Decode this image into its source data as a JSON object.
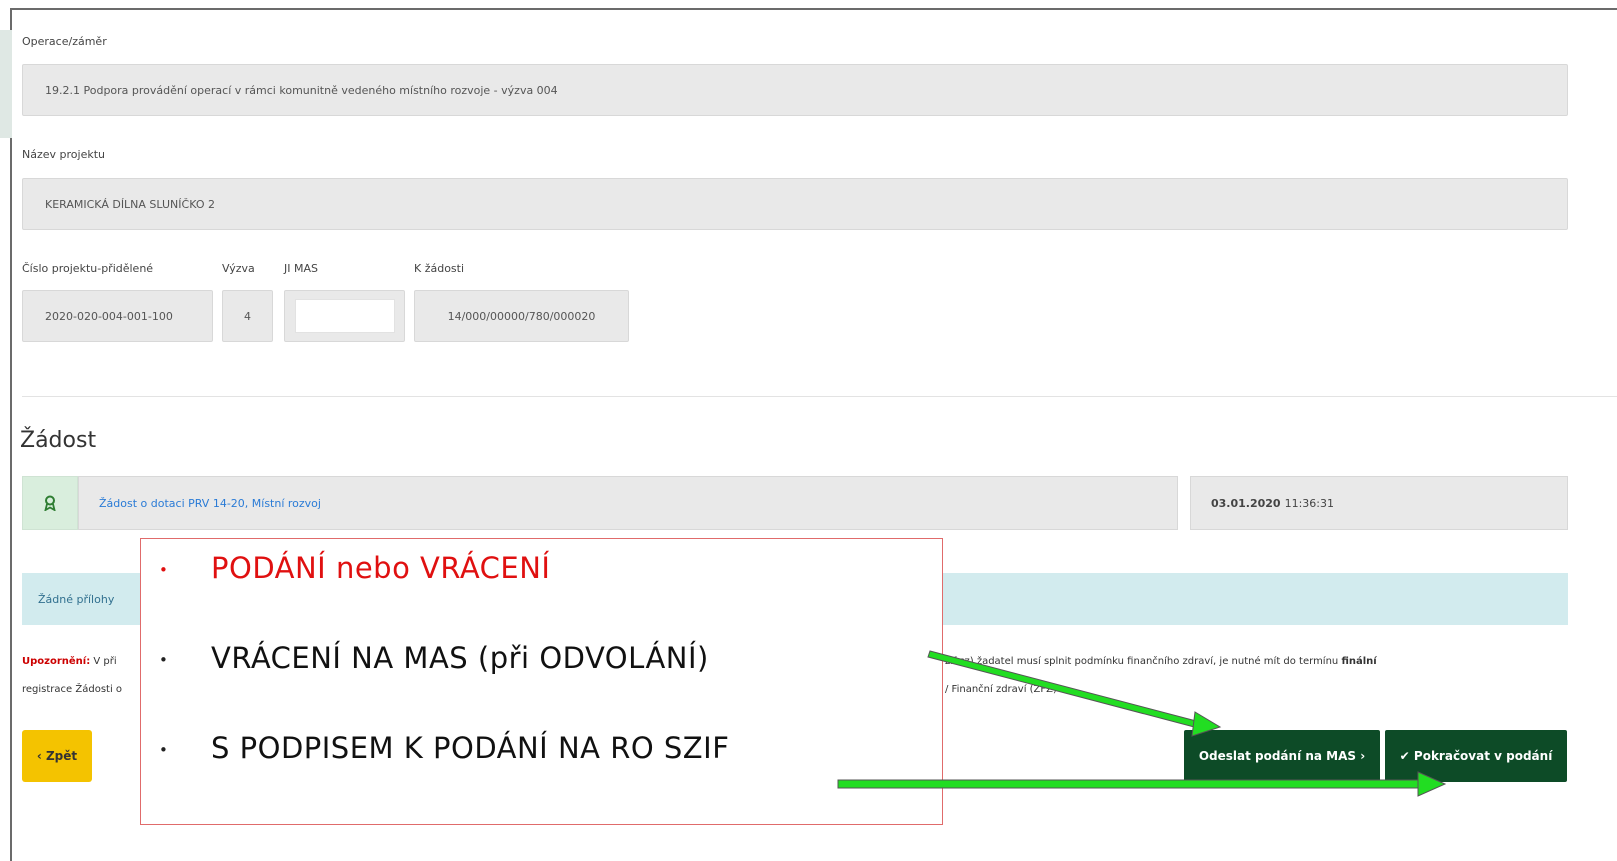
{
  "form": {
    "operation_label": "Operace/záměr",
    "operation_value": "19.2.1 Podpora provádění operací v rámci komunitně vedeného místního rozvoje - výzva 004",
    "project_name_label": "Název projektu",
    "project_name_value": "KERAMICKÁ DÍLNA SLUNÍČKO 2",
    "project_number_label": "Číslo projektu-přidělené",
    "project_number_value": "2020-020-004-001-100",
    "call_label": "Výzva",
    "call_value": "4",
    "mas_label": "JI MAS",
    "mas_value": "",
    "request_label": "K žádosti",
    "request_value": "14/000/00000/780/000020"
  },
  "zadost": {
    "section_title": "Žádost",
    "icon": "ribbon-award-icon",
    "link_text": "Žádost o dotaci PRV 14-20, Místní rozvoj",
    "date": "03.01.2020",
    "time": "11:36:31"
  },
  "attachments": {
    "empty_text": "Žádné přílohy"
  },
  "warning": {
    "strong": "Upozornění:",
    "line1_start": "V při",
    "line1_end": "zif.cz) žadatel musí splnit podmínku finančního zdraví, je nutné mít do termínu",
    "line1_bold_end": "finální",
    "line2_start": "registrace Žádosti o",
    "line2_end": "/ Finanční zdraví (ZFZ)"
  },
  "buttons": {
    "back": "‹ Zpět",
    "send": "Odeslat podání na MAS ›",
    "continue": "✔ Pokračovat v podání"
  },
  "overlay": {
    "items": [
      {
        "text": "PODÁNÍ nebo VRÁCENÍ",
        "color": "#e01010"
      },
      {
        "text": "VRÁCENÍ NA MAS (při ODVOLÁNÍ)",
        "color": "#111111"
      },
      {
        "text": "S PODPISEM K PODÁNÍ NA RO SZIF",
        "color": "#111111"
      }
    ],
    "bullet": "•"
  },
  "colors": {
    "primary_green": "#0d4b27",
    "back_yellow": "#f4c300",
    "arrow_green": "#22dd22",
    "link_blue": "#2a7bd6",
    "info_bg": "#d2ebee",
    "warning_red": "#cc0000"
  }
}
